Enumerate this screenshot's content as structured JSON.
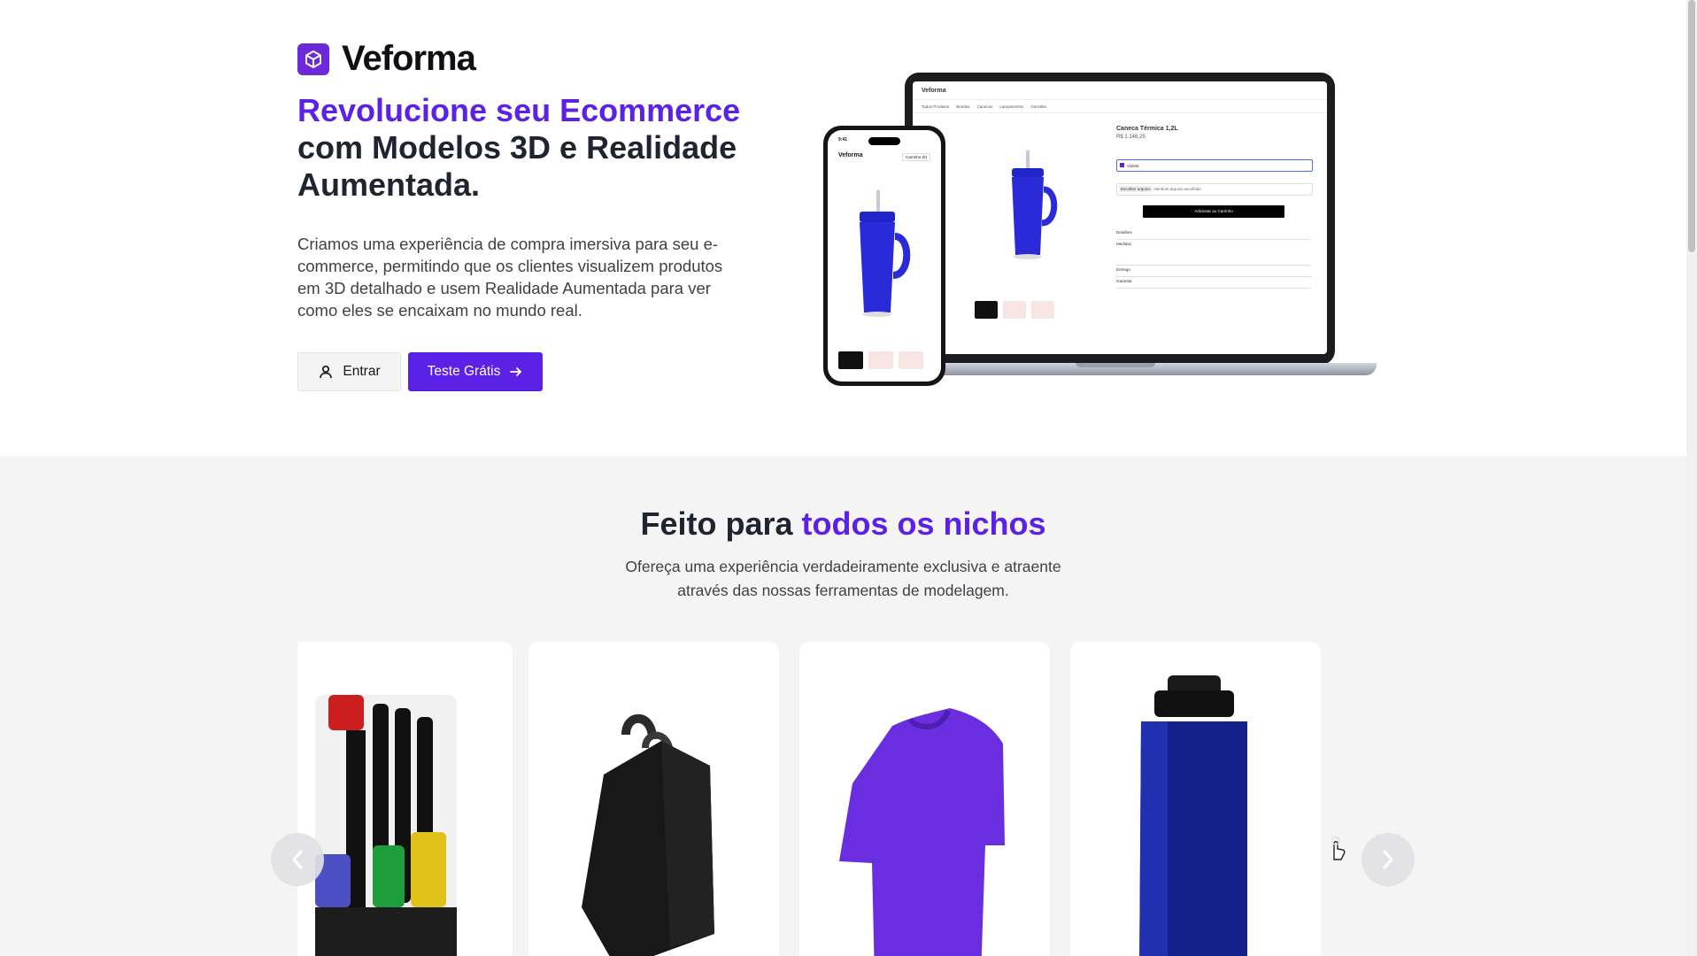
{
  "brand": {
    "name": "Veforma"
  },
  "hero": {
    "headline_accent": "Revolucione seu Ecommerce",
    "headline_rest": "com Modelos 3D e Realidade Aumentada.",
    "lead": "Criamos uma experiência de compra imersiva para seu e-commerce, permitindo que os clientes visualizem produtos em 3D detalhado e usem Realidade Aumentada para ver como eles se encaixam no mundo real.",
    "login_label": "Entrar",
    "trial_label": "Teste Grátis"
  },
  "mockup": {
    "store_name": "Veforma",
    "nav": [
      "Todos Produtos",
      "Brindes",
      "Canecas",
      "Lançamentos",
      "Garrafas"
    ],
    "product_title": "Caneca Térmica 1,2L",
    "product_price": "R$ 1.146,25",
    "color_value": "Violeta",
    "file_button": "Escolher arquivo",
    "file_status": "Nenhum arquivo escolhido",
    "buy_label": "Adicionar ao Carrinho",
    "sections": [
      "Detalhes",
      "Medidas",
      "Entrega",
      "Garantia"
    ],
    "phone_time": "9:41",
    "phone_cart": "Carrinho (0)"
  },
  "niches": {
    "title_plain": "Feito para ",
    "title_accent": "todos os nichos",
    "subtitle_line1": "Ofereça uma experiência verdadeiramente exclusiva e atraente",
    "subtitle_line2": "através das nossas ferramentas de modelagem."
  },
  "carousel": {
    "items": [
      "tool-set-product",
      "backpack-product",
      "tshirt-product",
      "bottle-product"
    ]
  },
  "colors": {
    "accent": "#5b21e6",
    "dark": "#1f2430",
    "section_bg": "#f4f4f5",
    "product_blue": "#2a2ad8",
    "shirt_purple": "#6a2ee0"
  }
}
